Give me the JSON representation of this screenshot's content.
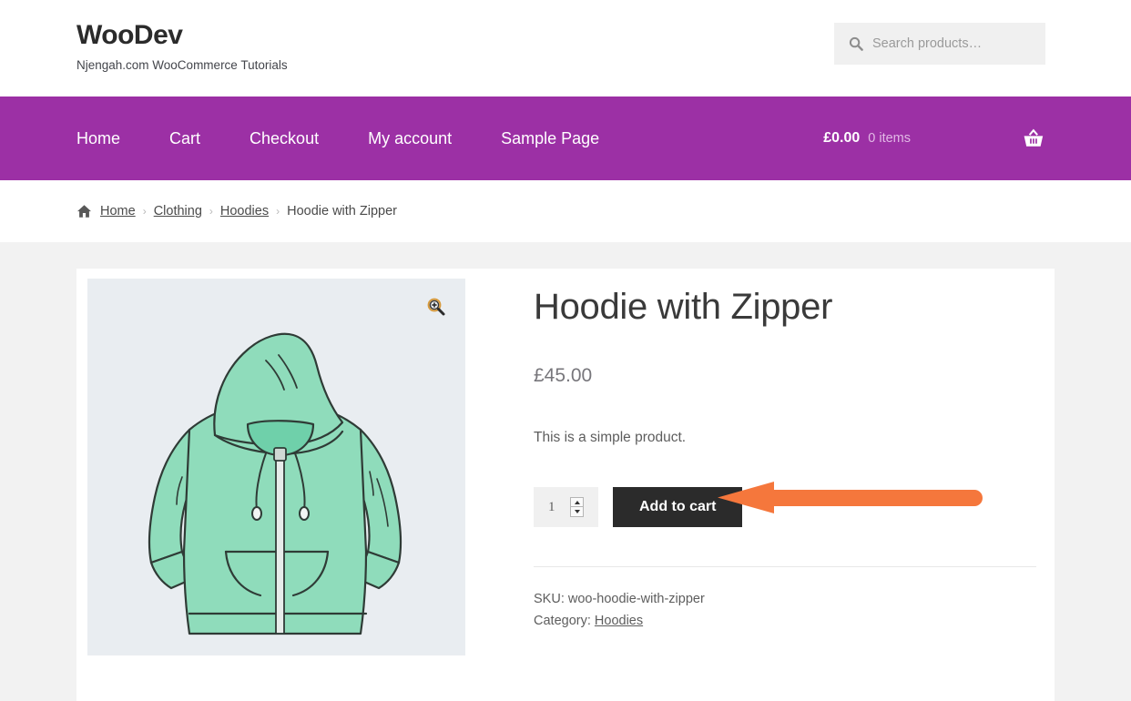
{
  "header": {
    "site_title": "WooDev",
    "tagline": "Njengah.com WooCommerce Tutorials",
    "search": {
      "placeholder": "Search products…",
      "value": "",
      "icon": "search-icon"
    }
  },
  "nav": {
    "background_color": "#9c30a5",
    "items": [
      {
        "label": "Home"
      },
      {
        "label": "Cart"
      },
      {
        "label": "Checkout"
      },
      {
        "label": "My account"
      },
      {
        "label": "Sample Page"
      }
    ],
    "cart": {
      "amount": "£0.00",
      "items_count": "0 items",
      "icon": "shopping-basket-icon"
    }
  },
  "breadcrumb": {
    "home_icon": "home-icon",
    "items": [
      {
        "label": "Home",
        "link": true
      },
      {
        "label": "Clothing",
        "link": true
      },
      {
        "label": "Hoodies",
        "link": true
      },
      {
        "label": "Hoodie with Zipper",
        "link": false
      }
    ],
    "separator": "›"
  },
  "product": {
    "title": "Hoodie with Zipper",
    "price": "£45.00",
    "short_description": "This is a simple product.",
    "image": {
      "alt": "hoodie-with-zipper-illustration",
      "background_color": "#e9edf1",
      "garment_color": "#8fdcbb",
      "zoom_icon": "magnifier-plus-icon"
    },
    "quantity": {
      "value": "1"
    },
    "add_to_cart_label": "Add to cart",
    "meta": {
      "sku_label": "SKU:",
      "sku_value": "woo-hoodie-with-zipper",
      "category_label": "Category:",
      "category_value": "Hoodies"
    }
  },
  "annotation": {
    "arrow_color": "#f5773c",
    "direction": "left",
    "points_at": "add-to-cart-button"
  }
}
